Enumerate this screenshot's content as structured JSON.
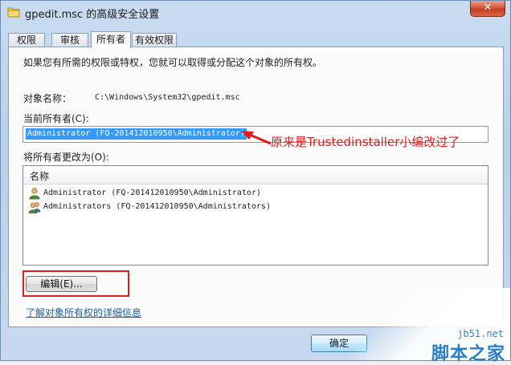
{
  "window": {
    "title": "gpedit.msc 的高级安全设置",
    "close_label": "✕"
  },
  "tabs": [
    {
      "label": "权限"
    },
    {
      "label": "审核"
    },
    {
      "label": "所有者",
      "active": true
    },
    {
      "label": "有效权限"
    }
  ],
  "panel": {
    "intro": "如果您有所需的权限或特权，您就可以取得或分配这个对象的所有权。",
    "object_name_label": "对象名称：",
    "object_name_value": "C:\\Windows\\System32\\gpedit.msc",
    "current_owner_label": "当前所有者(C):",
    "current_owner_value": "Administrator (FQ-201412010950\\Administrator)",
    "change_owner_label": "将所有者更改为(O):",
    "list_header": "名称",
    "owner_candidates": [
      {
        "name": "Administrator (FQ-201412010950\\Administrator)",
        "icon": "user-icon"
      },
      {
        "name": "Administrators (FQ-201412010950\\Administrators)",
        "icon": "user-group-icon"
      }
    ],
    "edit_button": "编辑(E)...",
    "link_text": "了解对象所有权的详细信息"
  },
  "annotation": {
    "text": "原来是Trustedinstaller小编改过了",
    "color": "#e51b1b"
  },
  "footer": {
    "ok_button": "确定"
  },
  "watermark": {
    "site": "jb51.net",
    "brand": "脚本之家"
  },
  "colors": {
    "selection": "#3399ff",
    "annotation_red": "#e51b1b",
    "link": "#1c5fa8"
  }
}
